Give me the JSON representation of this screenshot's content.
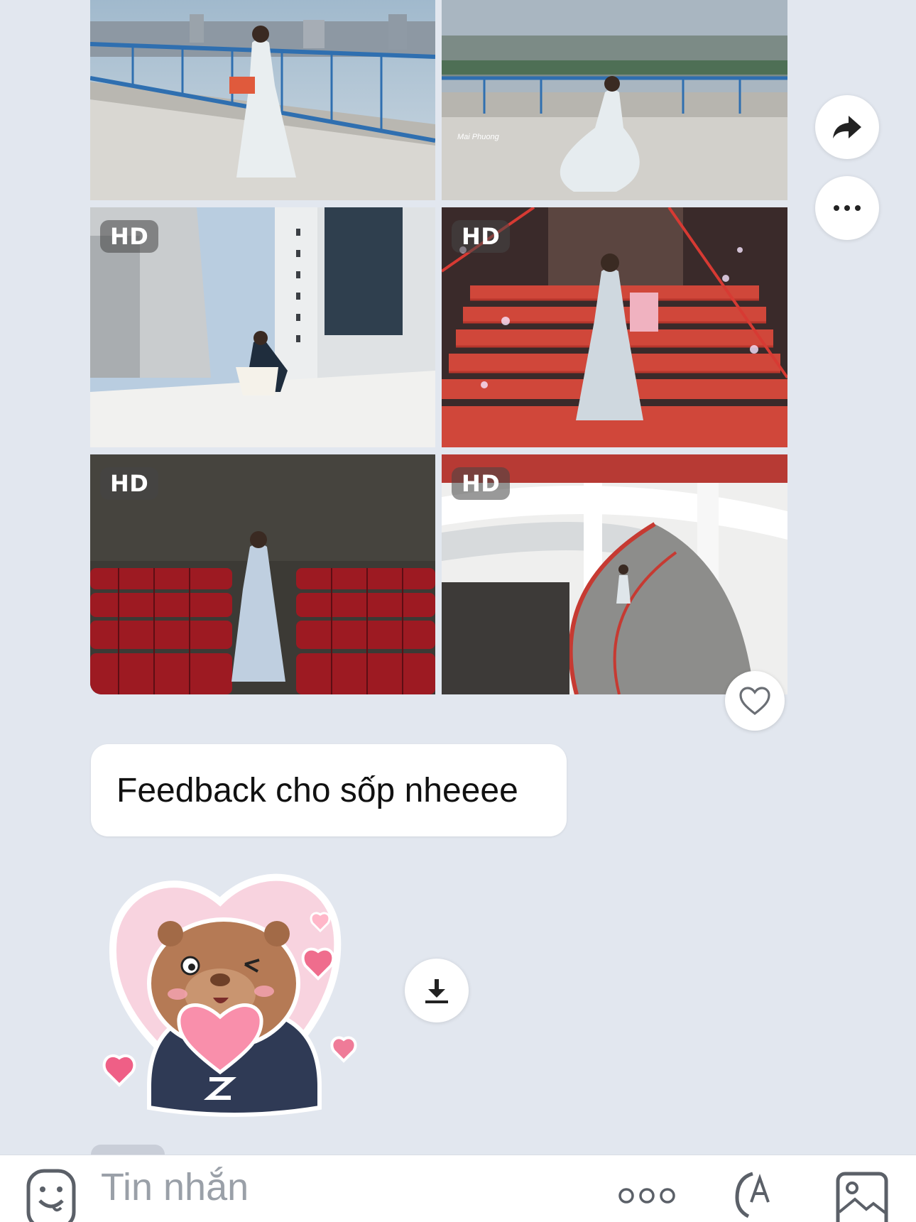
{
  "photos": [
    {
      "badge": "",
      "scene": "rooftop-city"
    },
    {
      "badge": "",
      "scene": "rooftop-panorama"
    },
    {
      "badge": "HD",
      "scene": "white-building"
    },
    {
      "badge": "HD",
      "scene": "red-staircase"
    },
    {
      "badge": "HD",
      "scene": "auditorium"
    },
    {
      "badge": "HD",
      "scene": "spiral-ramp"
    }
  ],
  "side_actions": {
    "share_icon": "share-arrow-icon",
    "more_icon": "more-dots-icon"
  },
  "message": {
    "text": "Feedback cho sốp nheeee"
  },
  "sticker": {
    "icon": "capybara-heart-sticker"
  },
  "composer": {
    "placeholder": "Tin nhắn",
    "icons": [
      "sticker-face-icon",
      "more-options-icon",
      "voice-text-icon",
      "gallery-icon"
    ]
  },
  "colors": {
    "background": "#e2e7ef",
    "bubble": "#ffffff",
    "heart": "#ef5f86"
  }
}
